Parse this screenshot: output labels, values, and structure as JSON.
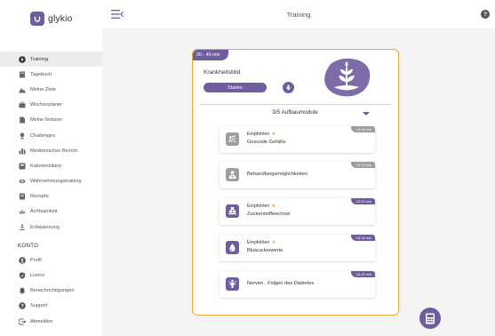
{
  "app": {
    "name": "glykio"
  },
  "header": {
    "title": "Training",
    "help_label": "?"
  },
  "sidebar": {
    "items": [
      {
        "label": "Training",
        "icon": "play-icon"
      },
      {
        "label": "Tagebuch",
        "icon": "notebook-icon"
      },
      {
        "label": "Meine Ziele",
        "icon": "mountain-icon"
      },
      {
        "label": "Wochenplaner",
        "icon": "briefcase-icon"
      },
      {
        "label": "Meine Notizen",
        "icon": "note-icon"
      },
      {
        "label": "Challenges",
        "icon": "trophy-icon"
      },
      {
        "label": "Medizinischer Bericht",
        "icon": "bar-chart-icon"
      },
      {
        "label": "Kalorienbilanz",
        "icon": "scale-icon"
      },
      {
        "label": "Wahrnehmungstraining",
        "icon": "eye-icon"
      },
      {
        "label": "Rezepte",
        "icon": "recipe-icon"
      },
      {
        "label": "Achtsamkeit",
        "icon": "lotus-icon"
      },
      {
        "label": "Entspannung",
        "icon": "meditation-icon"
      }
    ],
    "section_label": "KONTO",
    "account_items": [
      {
        "label": "Profil",
        "icon": "user-icon"
      },
      {
        "label": "Lizenz",
        "icon": "shield-icon"
      },
      {
        "label": "Benachrichtigungen",
        "icon": "bell-icon"
      },
      {
        "label": "Support",
        "icon": "help-icon"
      },
      {
        "label": "Abmelden",
        "icon": "logout-icon"
      }
    ]
  },
  "card": {
    "duration": "30 - 40 min",
    "heading": "Krankheitsbild",
    "start_label": "Starten",
    "module_progress": "3/5 Aufbaumodule",
    "modules": [
      {
        "recommended": "Empfohlen",
        "title": "Gesunde Gefäße",
        "time": "10-15 min",
        "status": "done",
        "icon": "vessel-icon"
      },
      {
        "recommended": "",
        "title": "Behandlungsmöglichkeiten",
        "time": "10-15 min",
        "status": "done",
        "icon": "doctor-icon"
      },
      {
        "recommended": "Empfohlen",
        "title": "Zuckerstoffwechsel",
        "time": "10-15 min",
        "status": "active",
        "icon": "sugar-cubes-icon"
      },
      {
        "recommended": "Empfohlen",
        "title": "Blutzuckerwerte",
        "time": "10-15 min",
        "status": "active",
        "icon": "blood-drop-icon"
      },
      {
        "recommended": "",
        "title": "Nerven , Folgen des Diabetes",
        "time": "10-15 min",
        "status": "active",
        "icon": "nerves-icon"
      }
    ]
  },
  "colors": {
    "accent": "#6f5e9e",
    "highlight": "#f0a73a",
    "done": "#9e9e9e",
    "active": "#6f5e9e"
  }
}
